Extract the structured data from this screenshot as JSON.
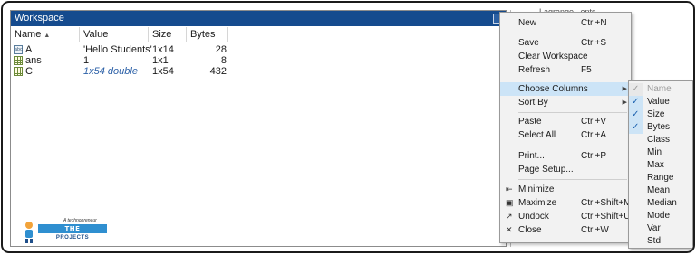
{
  "workspace": {
    "title": "Workspace",
    "columns": [
      "Name",
      "Value",
      "Size",
      "Bytes"
    ],
    "sort_indicator": "▲",
    "rows": [
      {
        "name": "A",
        "icon": "char-array-icon",
        "value": "'Hello Students'",
        "size": "1x14",
        "bytes": "28"
      },
      {
        "name": "ans",
        "icon": "matrix-icon",
        "value": "1",
        "size": "1x1",
        "bytes": "8"
      },
      {
        "name": "C",
        "icon": "matrix-icon",
        "value": "1x54 double",
        "size": "1x54",
        "bytes": "432"
      }
    ]
  },
  "background_panel": {
    "partial_text": "Lagrange...ents"
  },
  "logo": {
    "tagline": "A technopreneur",
    "line1": "THE ENGINEERING",
    "line2": "PROJECTS"
  },
  "context_menu": {
    "items": [
      {
        "label": "New",
        "shortcut": "Ctrl+N"
      },
      {
        "label": "Save",
        "shortcut": "Ctrl+S"
      },
      {
        "label": "Clear Workspace",
        "shortcut": ""
      },
      {
        "label": "Refresh",
        "shortcut": "F5"
      },
      {
        "label": "Choose Columns",
        "shortcut": "",
        "submenu": true
      },
      {
        "label": "Sort By",
        "shortcut": "",
        "submenu": true
      },
      {
        "label": "Paste",
        "shortcut": "Ctrl+V"
      },
      {
        "label": "Select All",
        "shortcut": "Ctrl+A"
      },
      {
        "label": "Print...",
        "shortcut": "Ctrl+P"
      },
      {
        "label": "Page Setup...",
        "shortcut": ""
      },
      {
        "label": "Minimize",
        "shortcut": "",
        "icon": "minimize-icon"
      },
      {
        "label": "Maximize",
        "shortcut": "Ctrl+Shift+M",
        "icon": "maximize-icon"
      },
      {
        "label": "Undock",
        "shortcut": "Ctrl+Shift+U",
        "icon": "undock-icon"
      },
      {
        "label": "Close",
        "shortcut": "Ctrl+W",
        "icon": "close-icon"
      }
    ]
  },
  "columns_submenu": {
    "items": [
      {
        "label": "Name",
        "checked": true,
        "disabled": true
      },
      {
        "label": "Value",
        "checked": true
      },
      {
        "label": "Size",
        "checked": true
      },
      {
        "label": "Bytes",
        "checked": true
      },
      {
        "label": "Class",
        "checked": false
      },
      {
        "label": "Min",
        "checked": false
      },
      {
        "label": "Max",
        "checked": false
      },
      {
        "label": "Range",
        "checked": false
      },
      {
        "label": "Mean",
        "checked": false
      },
      {
        "label": "Median",
        "checked": false
      },
      {
        "label": "Mode",
        "checked": false
      },
      {
        "label": "Var",
        "checked": false
      },
      {
        "label": "Std",
        "checked": false
      }
    ]
  },
  "colors": {
    "title_bar": "#154b8e",
    "highlight": "#cce4f7",
    "check": "#1e63b0"
  }
}
